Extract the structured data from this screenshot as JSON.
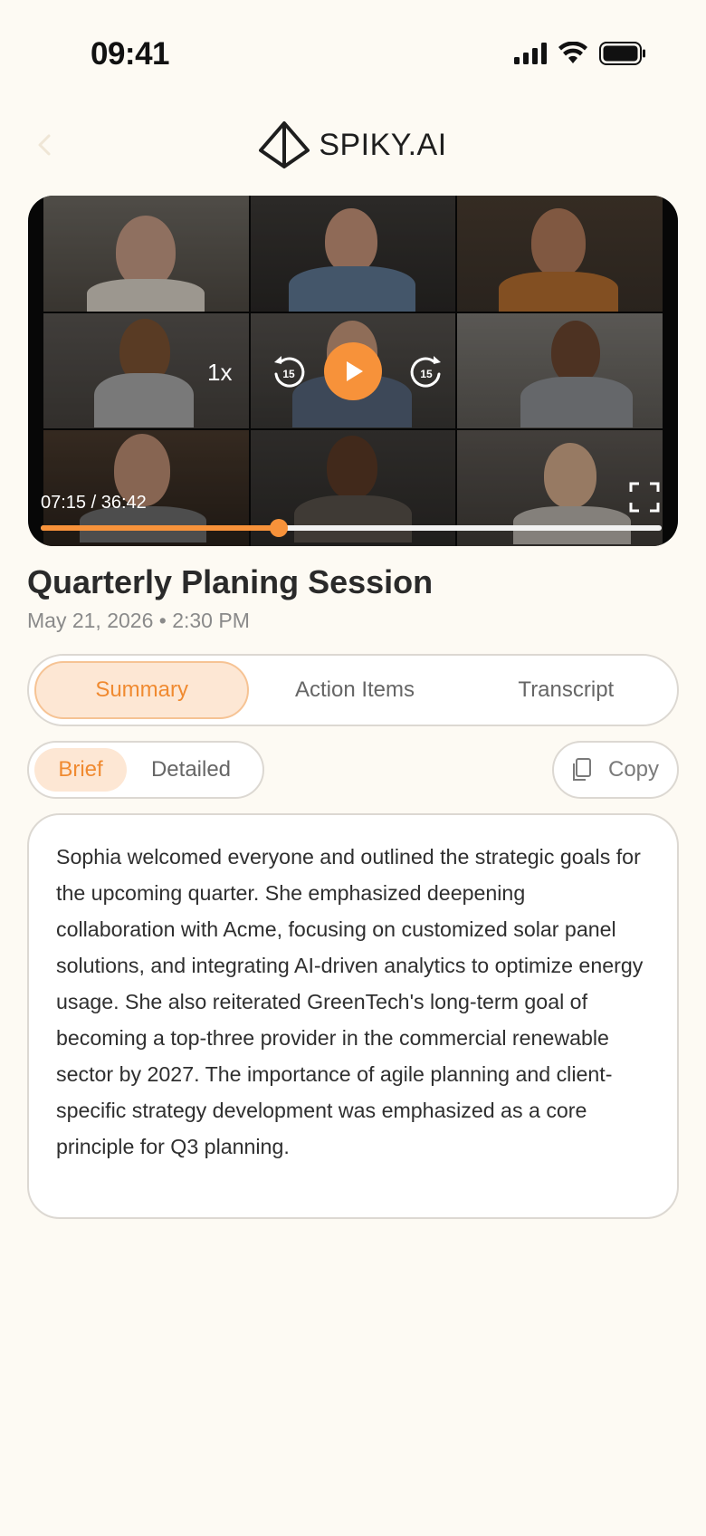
{
  "status_bar": {
    "time": "09:41",
    "icons": [
      "cellular-signal-icon",
      "wifi-icon",
      "battery-icon"
    ]
  },
  "header": {
    "brand": "SPIKY.AI",
    "back_icon": "chevron-left-icon",
    "logo_icon": "diamond-logo-icon"
  },
  "player": {
    "speed": "1x",
    "rewind_seconds": "15",
    "forward_seconds": "15",
    "timecode": "07:15 / 36:42",
    "progress": 0.383,
    "accent_color": "#f7923a"
  },
  "meeting": {
    "title": "Quarterly Planing Session",
    "date": "May 21, 2026 • 2:30 PM"
  },
  "tabs": [
    {
      "label": "Summary",
      "active": true
    },
    {
      "label": "Action Items",
      "active": false
    },
    {
      "label": "Transcript",
      "active": false
    }
  ],
  "mode_toggle": {
    "brief": "Brief",
    "detailed": "Detailed",
    "selected": "Brief"
  },
  "copy_button": {
    "label": "Copy",
    "icon": "copy-icon"
  },
  "summary": {
    "text": "Sophia welcomed everyone and outlined the strategic goals for the upcoming quarter. She emphasized deepening collaboration with Acme, focusing on customized solar panel solutions, and integrating AI-driven analytics to optimize energy usage. She also reiterated GreenTech's long-term goal of becoming a top-three provider in the commercial renewable sector by 2027. The importance of agile planning and client-specific strategy development was emphasized as a core principle for Q3 planning."
  }
}
